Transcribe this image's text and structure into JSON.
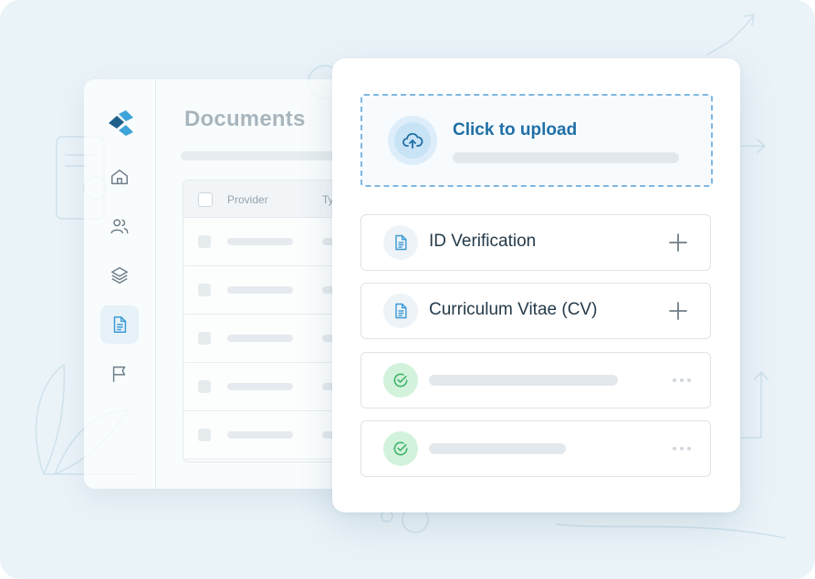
{
  "back_window": {
    "title": "Documents",
    "columns": [
      "Provider",
      "Ty"
    ],
    "row_count": 5
  },
  "sidebar": {
    "items": [
      {
        "icon": "home-icon",
        "active": false
      },
      {
        "icon": "users-icon",
        "active": false
      },
      {
        "icon": "layers-icon",
        "active": false
      },
      {
        "icon": "document-icon",
        "active": true
      },
      {
        "icon": "flag-icon",
        "active": false
      }
    ]
  },
  "upload": {
    "label": "Click to upload",
    "icon": "cloud-upload-icon"
  },
  "documents": [
    {
      "label": "ID Verification",
      "icon": "document-icon",
      "action_icon": "plus-icon"
    },
    {
      "label": "Curriculum Vitae (CV)",
      "icon": "document-icon",
      "action_icon": "plus-icon"
    }
  ],
  "completed": [
    {
      "icon": "check-circle-icon",
      "action_icon": "more-icon"
    },
    {
      "icon": "check-circle-icon",
      "action_icon": "more-icon"
    }
  ],
  "colors": {
    "background": "#eaf3f8",
    "accent": "#1f6fa6",
    "dashed_border": "#7fb6e0",
    "success": "#3fb36a",
    "success_bg": "#d3f2dc",
    "muted_title": "#a9b5bd",
    "icon_stroke": "#6d7d88"
  }
}
